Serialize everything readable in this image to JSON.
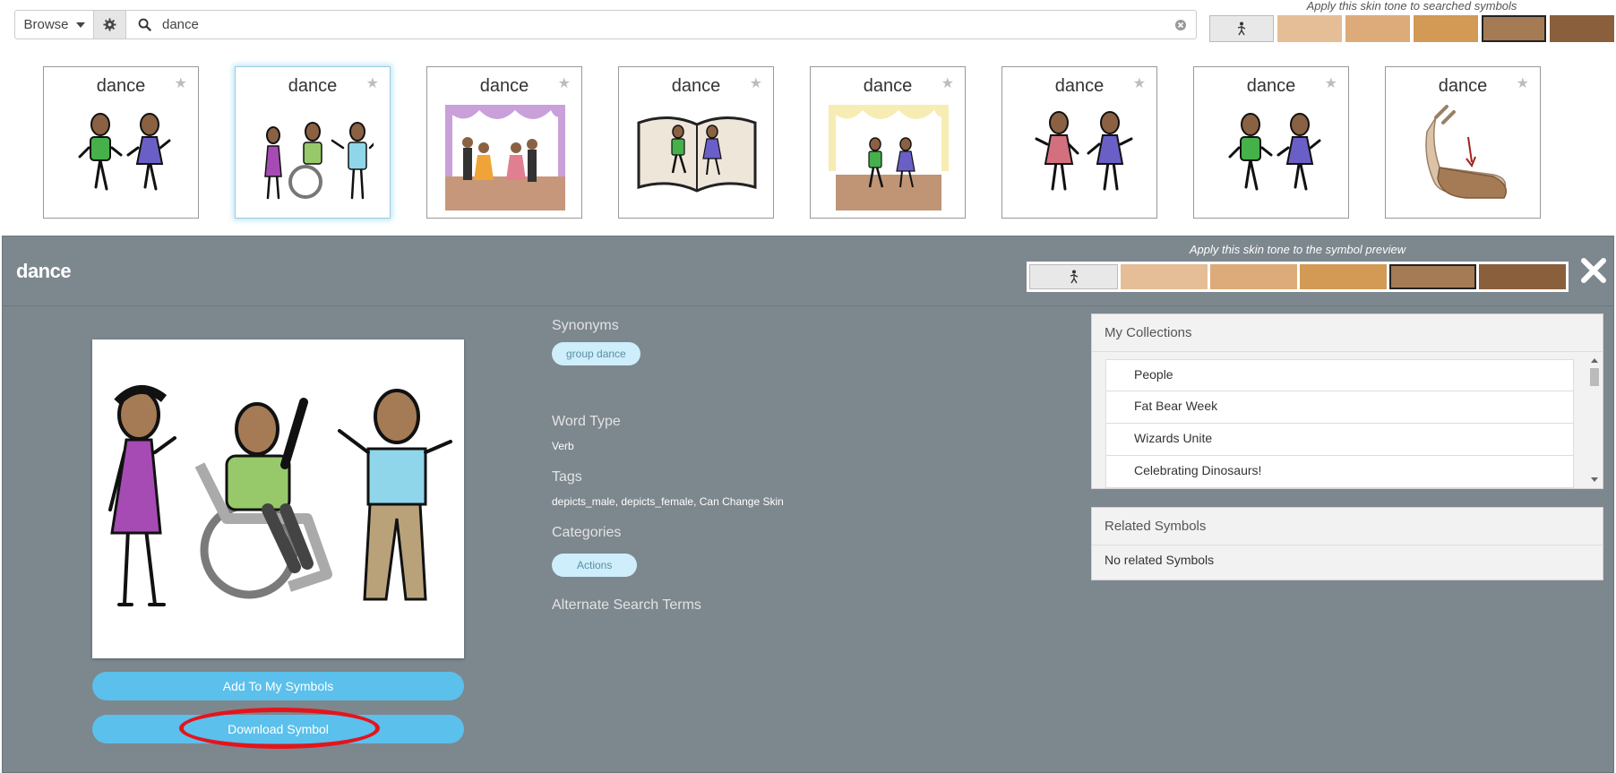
{
  "search": {
    "browse_label": "Browse",
    "value": "dance"
  },
  "top_skin": {
    "title": "Apply this skin tone to searched symbols",
    "swatches": [
      "neutral",
      "#e5bd96",
      "#ddaa79",
      "#d29a55",
      "#a47b55",
      "#8a5f3c"
    ],
    "selected_index": 4
  },
  "results": [
    {
      "label": "dance"
    },
    {
      "label": "dance"
    },
    {
      "label": "dance"
    },
    {
      "label": "dance"
    },
    {
      "label": "dance"
    },
    {
      "label": "dance"
    },
    {
      "label": "dance"
    },
    {
      "label": "dance"
    }
  ],
  "panel": {
    "title": "dance",
    "skin_title": "Apply this skin tone to the symbol preview",
    "synonyms_label": "Synonyms",
    "synonyms": [
      "group dance"
    ],
    "word_type_label": "Word Type",
    "word_type": "Verb",
    "tags_label": "Tags",
    "tags": "depicts_male, depicts_female, Can Change Skin",
    "categories_label": "Categories",
    "categories": [
      "Actions"
    ],
    "alt_terms_label": "Alternate Search Terms",
    "add_button": "Add To My Symbols",
    "download_button": "Download Symbol",
    "collections_title": "My Collections",
    "collections": [
      "People",
      "Fat Bear Week",
      "Wizards Unite",
      "Celebrating Dinosaurs!"
    ],
    "related_title": "Related Symbols",
    "related_empty": "No related Symbols"
  },
  "colors": {
    "panel_bg": "#7d878e",
    "button_blue": "#5bc0eb",
    "chip_bg": "#cdeefa",
    "highlight": "#e5141c"
  }
}
